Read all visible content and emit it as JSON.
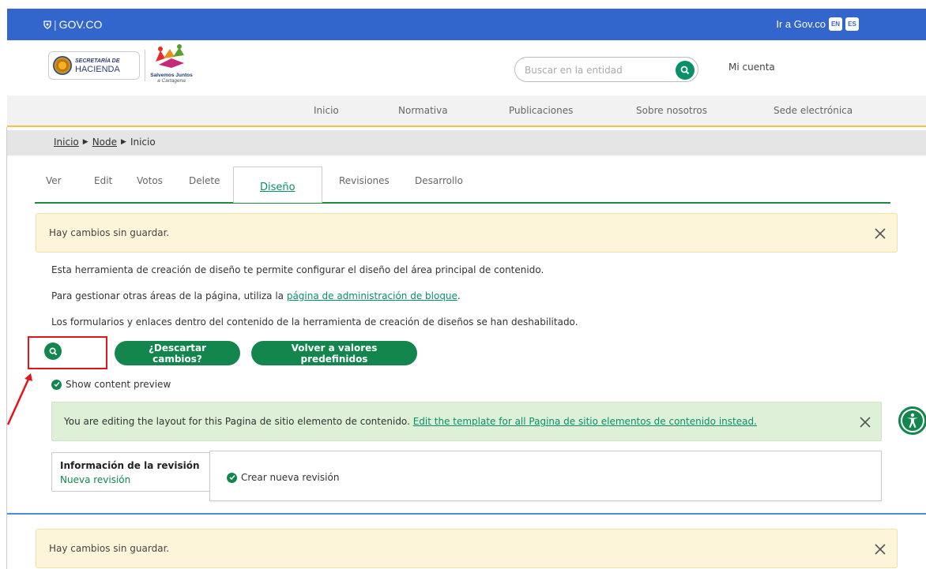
{
  "govbar": {
    "logo_text": "GOV.CO",
    "link_text": "Ir a Gov.co",
    "lang_en": "EN",
    "lang_es": "ES",
    "color": "#3366cc"
  },
  "header": {
    "logo_line1": "SECRETARÍA DE",
    "logo_line2": "HACIENDA",
    "brand_line1": "Salvemos Juntos",
    "brand_line2": "a Cartagena",
    "search_placeholder": "Buscar en la entidad",
    "account_label": "Mi cuenta"
  },
  "nav": {
    "items": [
      "Inicio",
      "Normativa",
      "Publicaciones",
      "Sobre nosotros",
      "Sede electrónica"
    ]
  },
  "breadcrumb": {
    "items": [
      "Inicio",
      "Node",
      "Inicio"
    ]
  },
  "tabs": {
    "items": [
      "Ver",
      "Edit",
      "Votos",
      "Delete",
      "Diseño",
      "Revisiones",
      "Desarrollo"
    ],
    "active": "Diseño"
  },
  "alerts": {
    "unsaved": "Hay cambios sin guardar.",
    "unsaved_bottom": "Hay cambios sin guardar."
  },
  "intro": {
    "p1": "Esta herramienta de creación de diseño te permite configurar el diseño del área principal de contenido.",
    "p2_before": "Para gestionar otras áreas de la página, utiliza la ",
    "p2_link": "página de administración de bloque",
    "p2_after": ".",
    "p3": "Los formularios y enlaces dentro del contenido de la herramienta de creación de diseños se han deshabilitado."
  },
  "actions": {
    "discard": "¿Descartar cambios?",
    "revert": "Volver a valores predefinidos",
    "preview_label": "Show content preview"
  },
  "info": {
    "text": "You are editing the layout for this Pagina de sitio elemento de contenido. ",
    "link": "Edit the template for all Pagina de sitio elementos de contenido instead."
  },
  "revision": {
    "title": "Información de la revisión",
    "subtitle": "Nueva revisión",
    "checkbox_label": "Crear nueva revisión"
  },
  "colors": {
    "accent_green": "#12864c",
    "nav_underline": "#f3c24a",
    "annotation_red": "#e3141b"
  }
}
